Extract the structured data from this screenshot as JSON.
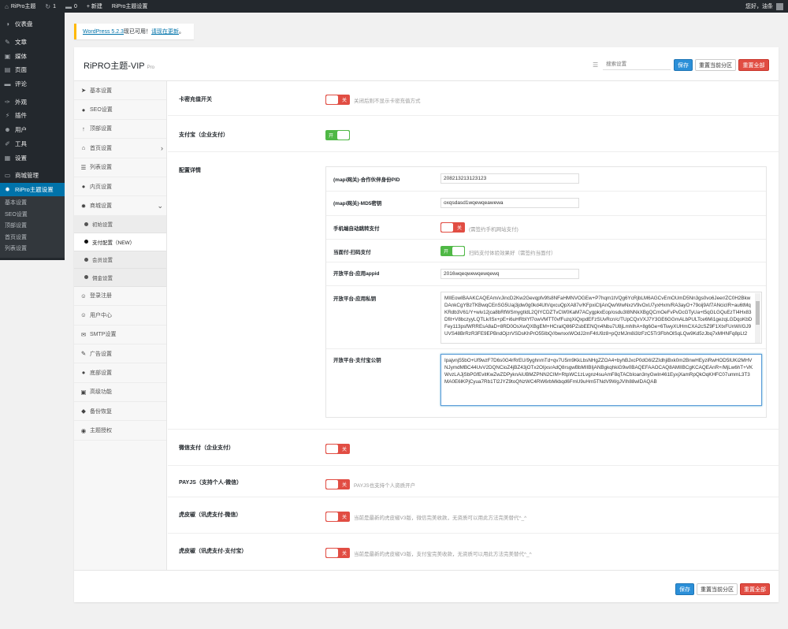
{
  "adminbar": {
    "site_name": "RiPro主题",
    "updates_count": "1",
    "comments_count": "0",
    "new_label": "+ 新建",
    "theme_settings": "RiPro主题设置",
    "greeting": "您好，油条"
  },
  "sidebar": {
    "items": [
      {
        "label": "仪表盘",
        "icon": "dashboard-icon",
        "glyph": "◑"
      },
      {
        "label": "文章",
        "icon": "pin-icon",
        "glyph": "✎"
      },
      {
        "label": "媒体",
        "icon": "media-icon",
        "glyph": "▣"
      },
      {
        "label": "页面",
        "icon": "page-icon",
        "glyph": "▤"
      },
      {
        "label": "评论",
        "icon": "comment-icon",
        "glyph": "▬"
      },
      {
        "label": "外观",
        "icon": "appearance-icon",
        "glyph": "✑"
      },
      {
        "label": "插件",
        "icon": "plugin-icon",
        "glyph": "⚡"
      },
      {
        "label": "用户",
        "icon": "users-icon",
        "glyph": "☻"
      },
      {
        "label": "工具",
        "icon": "tools-icon",
        "glyph": "✐"
      },
      {
        "label": "设置",
        "icon": "settings-icon",
        "glyph": "▦"
      },
      {
        "label": "商城管理",
        "icon": "shop-icon",
        "glyph": "▭"
      },
      {
        "label": "RiPro主题设置",
        "icon": "gear-icon",
        "glyph": "✹"
      }
    ],
    "submenu": [
      "基本设置",
      "SEO设置",
      "顶部设置",
      "首页设置",
      "列表设置"
    ]
  },
  "notice": {
    "link_version": "WordPress 5.2.3",
    "text_mid": "现已可用！",
    "link_update": "请现在更新",
    "text_end": "。"
  },
  "panel": {
    "title": "RiPRO主题-VIP",
    "title_suffix": "Pro",
    "search_placeholder": "搜索设置",
    "save_label": "保存",
    "reset_section_label": "重置当前分区",
    "reset_all_label": "重置全部"
  },
  "nav": {
    "items": [
      {
        "label": "基本设置",
        "icon": "paper-plane-icon",
        "glyph": "➤"
      },
      {
        "label": "SEO设置",
        "icon": "circle-icon",
        "glyph": "●"
      },
      {
        "label": "顶部设置",
        "icon": "arrow-up-icon",
        "glyph": "↑"
      },
      {
        "label": "首页设置",
        "icon": "home-icon",
        "glyph": "⌂",
        "chevron": "›"
      },
      {
        "label": "列表设置",
        "icon": "list-icon",
        "glyph": "☰"
      },
      {
        "label": "内页设置",
        "icon": "circle-icon",
        "glyph": "●"
      },
      {
        "label": "商城设置",
        "icon": "gear-icon",
        "glyph": "✹",
        "chevron": "⌄"
      }
    ],
    "sub_items": [
      {
        "label": "初始设置",
        "active": false
      },
      {
        "label": "支付配置（NEW）",
        "active": true
      },
      {
        "label": "会员设置",
        "active": false
      },
      {
        "label": "佣金设置",
        "active": false
      }
    ],
    "items_after": [
      {
        "label": "登录注册",
        "icon": "user-icon",
        "glyph": "☺"
      },
      {
        "label": "用户中心",
        "icon": "user-icon",
        "glyph": "☺"
      },
      {
        "label": "SMTP设置",
        "icon": "mail-icon",
        "glyph": "✉"
      },
      {
        "label": "广告设置",
        "icon": "wrench-icon",
        "glyph": "✎"
      },
      {
        "label": "底部设置",
        "icon": "circle-icon",
        "glyph": "●"
      },
      {
        "label": "高级功能",
        "icon": "window-icon",
        "glyph": "▣"
      },
      {
        "label": "备份恢复",
        "icon": "shield-icon",
        "glyph": "◆"
      },
      {
        "label": "主题授权",
        "icon": "eye-icon",
        "glyph": "◉"
      }
    ]
  },
  "fields": {
    "card": {
      "title": "卡密充值开关",
      "state": "关",
      "help": "关闭后则不显示卡密充值方式"
    },
    "alipay": {
      "title": "支付宝（企业支付）",
      "state": "开"
    },
    "config_title": "配置详情",
    "config": {
      "pid": {
        "label": "(mapi网关)-合作伙伴身份PID",
        "value": "208213213123123"
      },
      "md5": {
        "label": "(mapi网关)-MD5密钥",
        "value": "oxqsdasd1wqewqeawewa"
      },
      "mobile": {
        "label": "手机端自动跳转支付",
        "state": "关",
        "help": "(需签约手机网站支付)"
      },
      "f2f": {
        "label": "当面付-扫码支付",
        "state": "开",
        "help": "扫码支付体验效果好（需签约当面付）"
      },
      "appid": {
        "label": "开放平台-应用appid",
        "value": "2016wqeqwewqewqewq"
      },
      "private_key": {
        "label": "开放平台-应用私钥",
        "value": "MIIEowIBAAKCAQEAm/vJincD2Kw2Gevqpfv9fs8NFaHMNVOGEw+P7hqm1tVQg6YcRjbLM6AGCvEmOUmD5Nn3gs0vo6Jeer/ZC0H2BkwDAnkCgYBzTKBwqCEnSG5Uaj3jdw0g0kd4UtVqxcuQpXA87v/KFpxiCtjAnQw/WwNxzV9vOxU7yxHxm/RA3ayO+79oij9Af7ANcicIR+au6tMqKRdb3V61/Y+wiv12jca8bRfWSmygtIdL2QIYCDZTvCW0KaM7ACygpkxEop/osdu3I8NNkXBgQCmOeFvPvDcGTyUa+t5qGLGQuEzTI4Hx83Dfit+V8bczyyLQTLk/ISx+pE+i6uHRbIYf7owVMTT0vfFuzqXiQxpdEFzSUvRcn/c/TUpCQxVXJ7Y3GE6GGmALbPULTce6Mi1gezqLGDqoKbDFey113psfWRREsA8aD+8RD0OsXwQXBgEM+HCraIQ86PZsbEENQn4Nbu7U8jLmhIhA+8g6Ge+6TiwyXUHmCXA2cSZ9F1XtxFUnWI/GJ9UVS48BrRzR3FE9EPBndOjzrVSDsKhPrO55IbQ//bwnxxWOdJ2mF4tU9z8+pQzMJm8i3lzFzC5Tr3FbhOlSqLQw9Kd5zJbq7xMHNFq8pLt2"
      },
      "public_key": {
        "label": "开放平台-支付宝公钥",
        "value": "Ipajvnj55bO+Uf9wzF7D6s0G4rRrEU/9yghnmTd+qv7U5m9KkLbsNHgZZOA4+byhBJxcP0dG6IZZIdhjiBxk0m2BnwHEyziRwHOD5lUKi2MHVNJymdMBC44UvV2DQNCioZ4jBZ43jOTx2OIjxsrAdQ8rsgwBbMIIBIjANBgkqhkiG9w0BAQEFAAOCAQ8AMIIBCgKCAQEAnR+/MjLw6hT+VKWvzLAJjSbPGfEvitKwZwZDPyknAiUBMZPNN2CIM+RtpWC1zLvgnz4suAmF8qTACbIoan3nyGwIn461EyxjXamRpQkOqKHFC07ummL3T3MA0E6lKPjCyua7Rb1Tl2JYZ9toQNzWC4RW6rbMkbqd6FmU9uHm5TNdV9WgJVIh88wIDAQAB"
      }
    },
    "wechat": {
      "title": "微信支付（企业支付）",
      "state": "关"
    },
    "payjs": {
      "title": "PAYJS（支持个人-微信）",
      "state": "关",
      "help": "PAYJS也支持个人资质开户"
    },
    "xunhu_wx": {
      "title": "虎皮椒（讯虎支付-微信）",
      "state": "关",
      "help": "当前是最新的虎皮椒V3版，微信完美收款，无资质可以用此方法完美替代^_^"
    },
    "xunhu_ali": {
      "title": "虎皮椒（讯虎支付-支付宝）",
      "state": "关",
      "help": "当前是最新的虎皮椒V3版，支付宝完美收款，无资质可以用此方法完美替代^_^"
    }
  },
  "colors": {
    "accent": "#0073aa",
    "save_blue": "#2b8fd8",
    "danger_red": "#e14d43",
    "switch_green": "#4fb845",
    "notice_yellow": "#ffb900"
  }
}
